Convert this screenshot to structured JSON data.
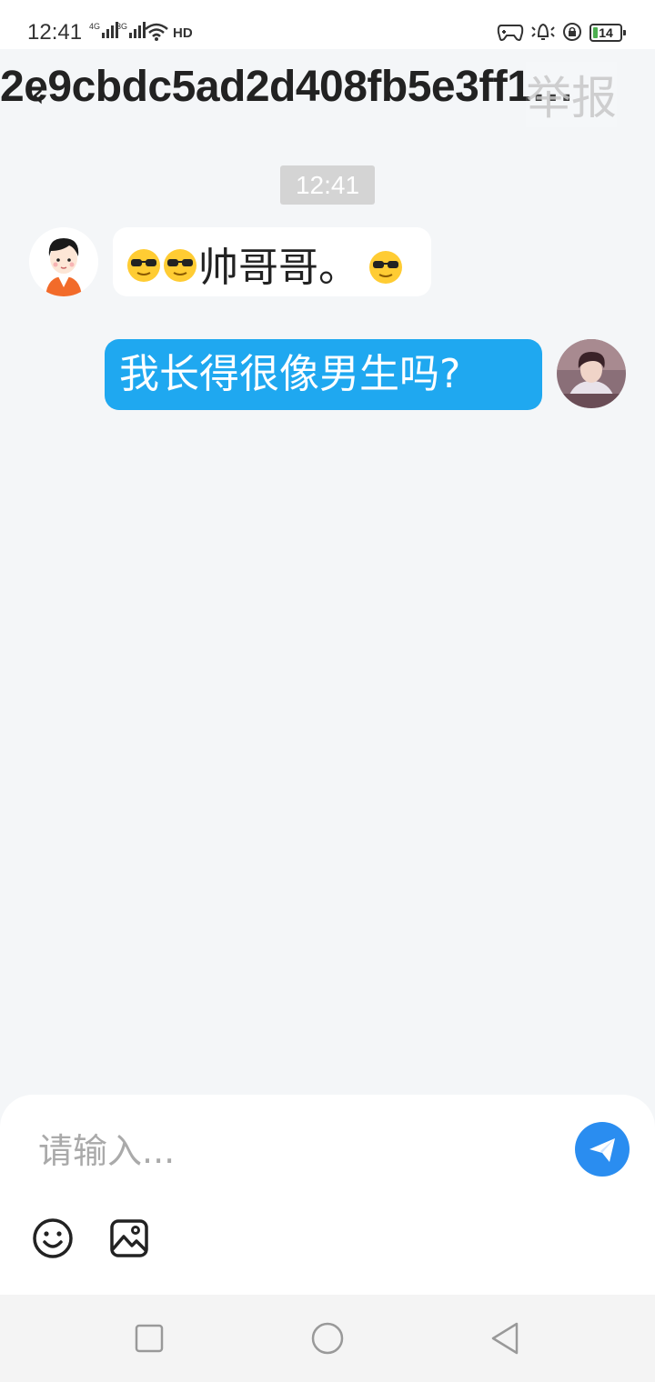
{
  "status_bar": {
    "time": "12:41",
    "network_1": "4G",
    "network_2": "3G",
    "battery": "14"
  },
  "header": {
    "title": "2e9cbdc5ad2d408fb5e3ff1…",
    "back_icon": "back-arrow-icon",
    "report_label": "举报"
  },
  "chat": {
    "timestamp": "12:41",
    "incoming": {
      "text": "帅哥哥。",
      "emoji": "sunglasses-emoji"
    },
    "outgoing": {
      "text": "我长得很像男生吗?"
    }
  },
  "composer": {
    "placeholder": "请输入...",
    "send_icon": "paper-plane-icon",
    "emoji_icon": "smiley-icon",
    "image_icon": "image-icon"
  },
  "nav": {
    "recent_icon": "square-icon",
    "home_icon": "circle-icon",
    "back_icon": "triangle-back-icon"
  },
  "colors": {
    "accent_send": "#2a8df0",
    "outgoing_bubble": "#1fa8f0",
    "background": "#f4f6f8"
  }
}
